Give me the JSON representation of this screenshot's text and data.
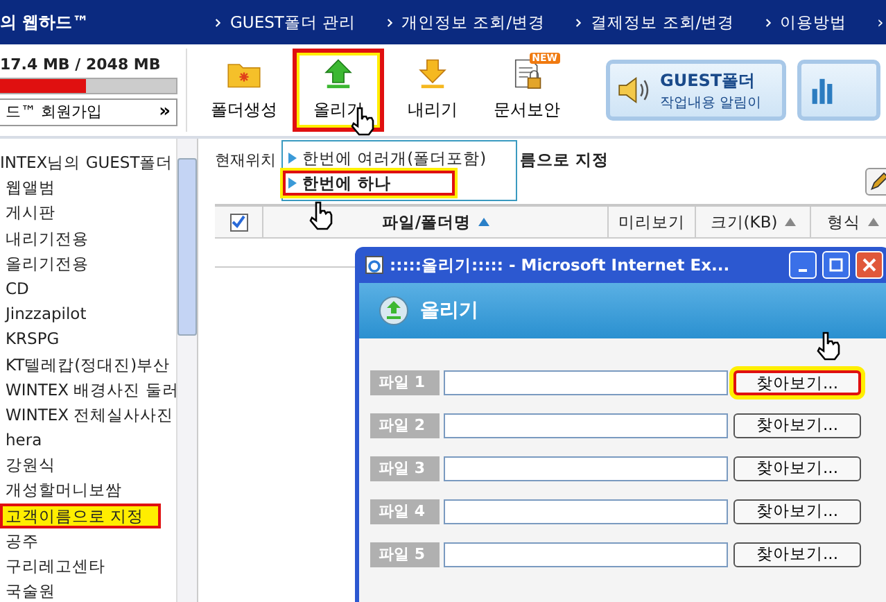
{
  "nav": {
    "brand": "의 웹하드™",
    "links": [
      "GUEST폴더 관리",
      "개인정보 조회/변경",
      "결제정보 조회/변경",
      "이용방법"
    ],
    "more": "›"
  },
  "storage": {
    "usage": "17.4 MB / 2048 MB",
    "level": 0.49
  },
  "join_button": {
    "label": "드™ 회원가입",
    "arrow": "»"
  },
  "tools": [
    {
      "label": "폴더생성",
      "kind": "folder",
      "highlighted": false
    },
    {
      "label": "올리기",
      "kind": "upload",
      "highlighted": true
    },
    {
      "label": "내리기",
      "kind": "download",
      "highlighted": false
    },
    {
      "label": "문서보안",
      "kind": "secure",
      "highlighted": false,
      "badge": "NEW"
    }
  ],
  "notice_button": {
    "title": "GUEST폴더",
    "subtitle": "작업내용 알림이"
  },
  "sidebar": {
    "items": [
      {
        "label": "INTEX님의 GUEST폴더",
        "selected": false,
        "children": [
          {
            "label": "웹앨범",
            "selected": false
          },
          {
            "label": "게시판",
            "selected": false
          },
          {
            "label": "내리기전용",
            "selected": false
          },
          {
            "label": "올리기전용",
            "selected": false
          },
          {
            "label": "CD",
            "selected": false
          },
          {
            "label": "Jinzzapilot",
            "selected": false
          },
          {
            "label": "KRSPG",
            "selected": false
          },
          {
            "label": "KT텔레캅(정대진)부산",
            "selected": false
          },
          {
            "label": "WINTEX 배경사진 둘러",
            "selected": false
          },
          {
            "label": "WINTEX 전체실사사진",
            "selected": false
          },
          {
            "label": "hera",
            "selected": false
          },
          {
            "label": "강원식",
            "selected": false
          },
          {
            "label": "개성할머니보쌈",
            "selected": false
          },
          {
            "label": "고객이름으로 지정",
            "selected": true
          },
          {
            "label": "공주",
            "selected": false
          },
          {
            "label": "구리레고센타",
            "selected": false
          },
          {
            "label": "국술원",
            "selected": false
          }
        ]
      }
    ]
  },
  "location": {
    "label": "현재위치",
    "path": "름으로 지정"
  },
  "table": {
    "select_all": {
      "checked": true
    },
    "columns": [
      {
        "label": "파일/폴더명",
        "sortable": true
      },
      {
        "label": "미리보기",
        "sortable": false
      },
      {
        "label": "크기(KB)",
        "sortable": true
      },
      {
        "label": "형식",
        "sortable": true
      }
    ]
  },
  "upload_menu": {
    "items": [
      {
        "label": "한번에 여러개(폴더포함)",
        "selected": false
      },
      {
        "label": "한번에 하나",
        "selected": true
      }
    ]
  },
  "popup": {
    "title": ":::::올리기::::: - Microsoft Internet Ex...",
    "heading": "올리기",
    "files": [
      {
        "label": "파일 1",
        "button": "찾아보기...",
        "highlighted": true
      },
      {
        "label": "파일 2",
        "button": "찾아보기...",
        "highlighted": false
      },
      {
        "label": "파일 3",
        "button": "찾아보기...",
        "highlighted": false
      },
      {
        "label": "파일 4",
        "button": "찾아보기...",
        "highlighted": false
      },
      {
        "label": "파일 5",
        "button": "찾아보기...",
        "highlighted": false
      }
    ]
  }
}
